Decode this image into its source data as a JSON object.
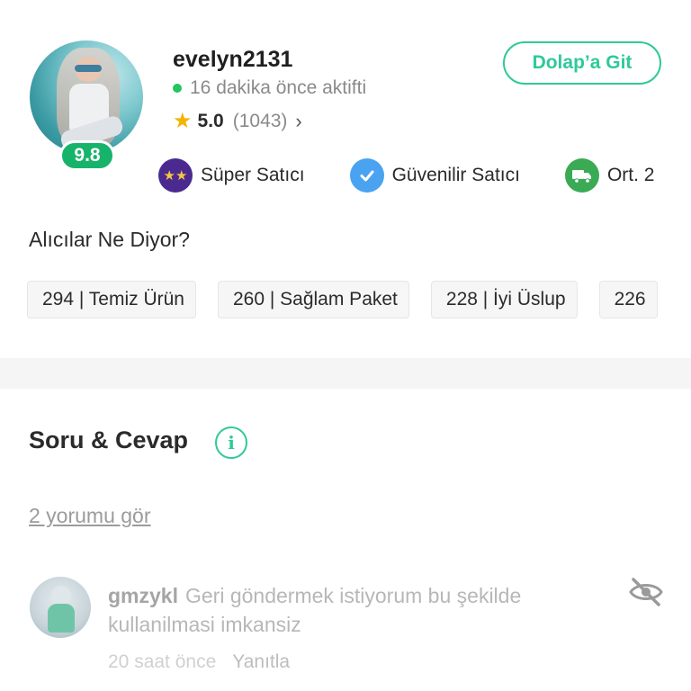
{
  "seller": {
    "username": "evelyn2131",
    "status": "16 dakika önce aktifti",
    "rating": "5.0",
    "rating_count": "(1043)",
    "score": "9.8",
    "go_button": "Dolap’a Git"
  },
  "badges": [
    {
      "label": "Süper Satıcı",
      "icon": "super-seller-icon"
    },
    {
      "label": "Güvenilir Satıcı",
      "icon": "verified-icon"
    },
    {
      "label": "Ort. 2",
      "icon": "shipping-truck-icon"
    }
  ],
  "buyers": {
    "title": "Alıcılar Ne Diyor?",
    "chips": [
      "294 | Temiz Ürün",
      "260 | Sağlam Paket",
      "228 | İyi Üslup",
      "226"
    ]
  },
  "qa": {
    "title": "Soru & Cevap",
    "see_comments": "2 yorumu gör",
    "comment": {
      "username": "gmzykl",
      "text": "Geri göndermek istiyorum bu şekilde kullanilmasi imkansiz",
      "time": "20 saat önce",
      "reply": "Yanıtla"
    }
  },
  "colors": {
    "accent": "#2fc99a",
    "score_badge": "#18b36b",
    "online_dot": "#22c55e"
  }
}
